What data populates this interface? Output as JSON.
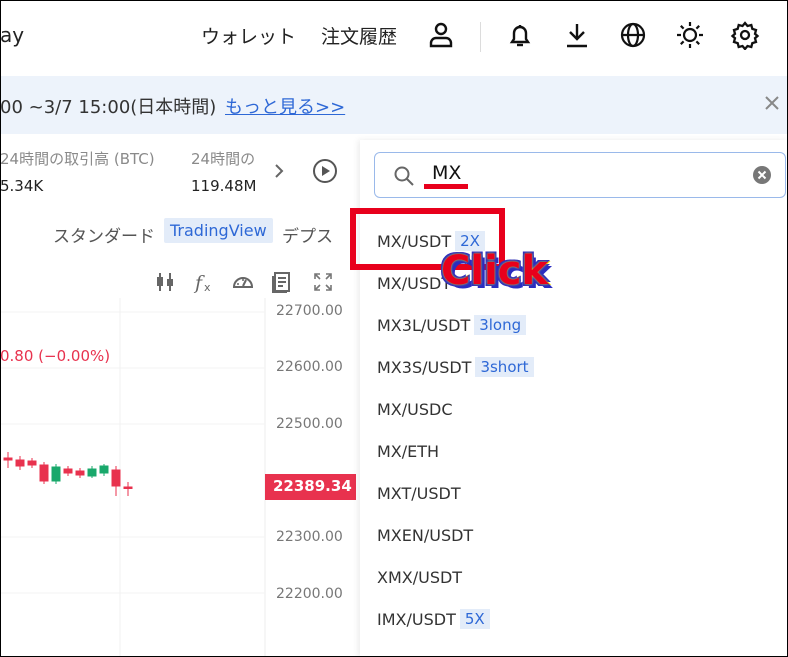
{
  "header": {
    "brand_fragment": "ay",
    "nav": [
      {
        "label": "ウォレット"
      },
      {
        "label": "注文履歴"
      }
    ],
    "icons": [
      "user-icon",
      "bell-icon",
      "download-icon",
      "globe-icon",
      "sun-icon",
      "gear-icon"
    ]
  },
  "banner": {
    "text": "00 ~3/7 15:00(日本時間)",
    "link": "もっと見る>>"
  },
  "stats": [
    {
      "label": "24時間の取引高 (BTC)",
      "value": "5.34K"
    },
    {
      "label": "24時間の",
      "value": "119.48M"
    }
  ],
  "chart": {
    "tabs": [
      "スタンダード",
      "TradingView",
      "デプス"
    ],
    "active_tab": "TradingView",
    "change_text": "0.80 (−0.00%)",
    "price_levels": [
      "22700.00",
      "22600.00",
      "22500.00",
      "22300.00",
      "22200.00"
    ],
    "current_price": "22389.34",
    "tool_icons": [
      "candle-icon",
      "function-icon",
      "gauge-icon",
      "notes-icon",
      "fullscreen-icon"
    ]
  },
  "search": {
    "value": "MX",
    "results": [
      {
        "pair": "MX/USDT",
        "badge": "2X"
      },
      {
        "pair": "MX/USDT",
        "badge": ""
      },
      {
        "pair": "MX3L/USDT",
        "badge": "3long"
      },
      {
        "pair": "MX3S/USDT",
        "badge": "3short"
      },
      {
        "pair": "MX/USDC",
        "badge": ""
      },
      {
        "pair": "MX/ETH",
        "badge": ""
      },
      {
        "pair": "MXT/USDT",
        "badge": ""
      },
      {
        "pair": "MXEN/USDT",
        "badge": ""
      },
      {
        "pair": "XMX/USDT",
        "badge": ""
      },
      {
        "pair": "IMX/USDT",
        "badge": "5X"
      }
    ]
  },
  "annotation": {
    "label": "Click",
    "color": "#e8001c"
  },
  "colors": {
    "accent": "#2e68d6",
    "down": "#e8324e",
    "up": "#19a86b",
    "banner_bg": "#edf3fb"
  }
}
